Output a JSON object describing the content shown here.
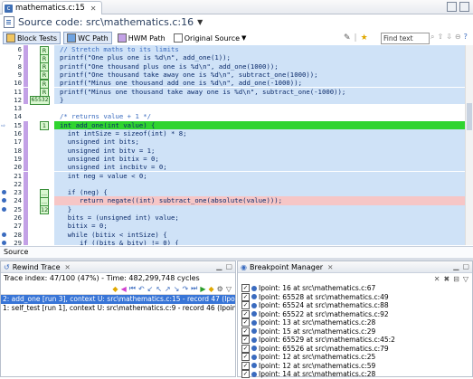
{
  "tab": {
    "label": "mathematics.c:15"
  },
  "title": {
    "text": "Source code: src\\mathematics.c:16"
  },
  "toolbar": {
    "block_tests": "Block Tests",
    "wc_path": "WC Path",
    "hwm_path": "HWM Path",
    "original_source": "Original Source",
    "find_placeholder": "Find text"
  },
  "editor": {
    "lines": [
      {
        "ln": "6",
        "code": "// Stretch maths to its limits",
        "kind": "comment",
        "bg": "blue",
        "marker": "R"
      },
      {
        "ln": "7",
        "code": "printf(\"One plus one is %d\\n\", add_one(1));",
        "bg": "blue",
        "marker": "R"
      },
      {
        "ln": "8",
        "code": "printf(\"One thousand plus one is %d\\n\", add_one(1000));",
        "bg": "blue",
        "marker": "R"
      },
      {
        "ln": "9",
        "code": "printf(\"One thousand take away one is %d\\n\", subtract_one(1000));",
        "bg": "blue",
        "marker": "R"
      },
      {
        "ln": "10",
        "code": "printf(\"Minus one thousand add one is %d\\n\", add_one(-1000));",
        "bg": "blue",
        "marker": "R"
      },
      {
        "ln": "11",
        "code": "printf(\"Minus one thousand take away one is %d\\n\", subtract_one(-1000));",
        "bg": "blue",
        "marker": "R"
      },
      {
        "ln": "12",
        "code": "}",
        "bg": "blue",
        "markerWide": "65532"
      },
      {
        "ln": "13",
        "code": "",
        "bg": "none"
      },
      {
        "ln": "14",
        "code": "/* returns value + 1 */",
        "kind": "comment",
        "bg": "none"
      },
      {
        "ln": "15",
        "code": "int add_one(int value) {",
        "bg": "green",
        "marker": "1"
      },
      {
        "ln": "16",
        "code": "  int intSize = sizeof(int) * 8;",
        "bg": "blue"
      },
      {
        "ln": "17",
        "code": "  unsigned int bits;",
        "bg": "blue"
      },
      {
        "ln": "18",
        "code": "  unsigned int bitv = 1;",
        "bg": "blue"
      },
      {
        "ln": "19",
        "code": "  unsigned int bitix = 0;",
        "bg": "blue"
      },
      {
        "ln": "20",
        "code": "  unsigned int incbitv = 0;",
        "bg": "blue"
      },
      {
        "ln": "21",
        "code": "  int neg = value < 0;",
        "bg": "blue"
      },
      {
        "ln": "22",
        "code": "",
        "bg": "blue"
      },
      {
        "ln": "23",
        "code": "  if (neg) {",
        "bg": "blue",
        "marker": "..."
      },
      {
        "ln": "24",
        "code": "     return negate((int) subtract_one(absolute(value)));",
        "bg": "pink",
        "marker": "..."
      },
      {
        "ln": "25",
        "code": "  }",
        "bg": "blue",
        "marker": "12"
      },
      {
        "ln": "26",
        "code": "  bits = (unsigned int) value;",
        "bg": "blue"
      },
      {
        "ln": "27",
        "code": "  bitix = 0;",
        "bg": "blue"
      },
      {
        "ln": "28",
        "code": "  while (bitix < intSize) {",
        "bg": "blue"
      },
      {
        "ln": "29",
        "code": "     if ((bits & bitv) != 0) {",
        "bg": "blue"
      },
      {
        "ln": "30",
        "code": "        bits = bits & ~bitv;",
        "bg": "blue"
      }
    ]
  },
  "source_tab": "Source",
  "rewind": {
    "title": "Rewind Trace",
    "trace_index": "Trace index: 47/100 (47%) - Time: 482,299,748 cycles",
    "items": [
      "2: add_one [run 3], context U: src\\mathematics.c:15 - record 47 (Ipoint Context)",
      "1: self_test [run 1], context U: src\\mathematics.c:9 - record 46 (Ipoint Context)"
    ]
  },
  "breakpoints": {
    "title": "Breakpoint Manager",
    "items": [
      "Ipoint: 16 at src\\mathematics.c:67",
      "Ipoint: 65528 at src\\mathematics.c:49",
      "Ipoint: 65524 at src\\mathematics.c:88",
      "Ipoint: 65522 at src\\mathematics.c:92",
      "Ipoint: 13 at src\\mathematics.c:28",
      "Ipoint: 15 at src\\mathematics.c:29",
      "Ipoint: 65529 at src\\mathematics.c:45:2",
      "Ipoint: 65526 at src\\mathematics.c:79",
      "Ipoint: 12 at src\\mathematics.c:25",
      "Ipoint: 12 at src\\mathematics.c:59",
      "Ipoint: 14 at src\\mathematics.c:28"
    ]
  },
  "colors": {
    "accent": "#3875d7",
    "exec_line": "#2fd42f",
    "bp_line": "#f6c6c6",
    "covered": "#cfe2f7"
  }
}
